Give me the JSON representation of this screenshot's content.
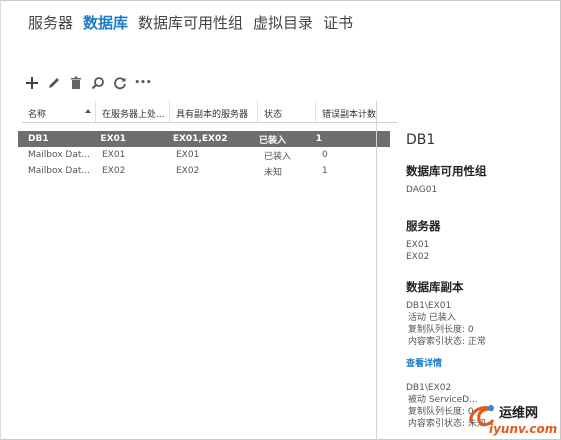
{
  "tabs": [
    {
      "label": "服务器",
      "active": false
    },
    {
      "label": "数据库",
      "active": true
    },
    {
      "label": "数据库可用性组",
      "active": false
    },
    {
      "label": "虚拟目录",
      "active": false
    },
    {
      "label": "证书",
      "active": false
    }
  ],
  "toolbar": {
    "add_icon": "plus-icon",
    "edit_icon": "pencil-icon",
    "delete_icon": "trash-icon",
    "search_icon": "search-icon",
    "refresh_icon": "refresh-icon",
    "more_label": "•••"
  },
  "grid": {
    "columns": [
      "名称",
      "在服务器上处...",
      "具有副本的服务器",
      "状态",
      "错误副本计数"
    ],
    "rows": [
      {
        "name": "DB1",
        "server": "EX01",
        "replicas": "EX01,EX02",
        "status": "已装入",
        "errors": "1",
        "selected": true
      },
      {
        "name": "Mailbox Dat...",
        "server": "EX01",
        "replicas": "EX01",
        "status": "已装入",
        "errors": "0",
        "selected": false
      },
      {
        "name": "Mailbox Dat...",
        "server": "EX02",
        "replicas": "EX02",
        "status": "未知",
        "errors": "1",
        "selected": false
      }
    ]
  },
  "details": {
    "title": "DB1",
    "dag_heading": "数据库可用性组",
    "dag_value": "DAG01",
    "servers_heading": "服务器",
    "servers": [
      "EX01",
      "EX02"
    ],
    "copies_heading": "数据库副本",
    "copy1": {
      "name": "DB1\\EX01",
      "line1": "活动 已装入",
      "line2": "复制队列长度: 0",
      "line3": "内容索引状态: 正常"
    },
    "view_details": "查看详情",
    "copy2": {
      "name": "DB1\\EX02",
      "line1": "被动 ServiceD...",
      "line2": "复制队列长度: 0",
      "line3": "内容索引状态: 未知"
    }
  },
  "watermark": {
    "cn": "运维网",
    "en": "iyunv.com"
  },
  "colors": {
    "accent": "#1e7bc8",
    "selected_row": "#6e6e6e"
  }
}
